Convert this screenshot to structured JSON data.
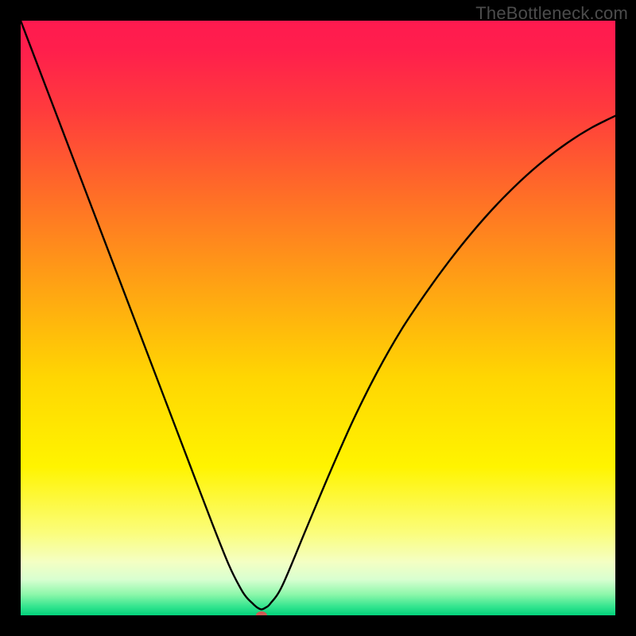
{
  "watermark": "TheBottleneck.com",
  "chart_data": {
    "type": "line",
    "title": "",
    "xlabel": "",
    "ylabel": "",
    "xlim": [
      0,
      100
    ],
    "ylim": [
      0,
      100
    ],
    "grid": false,
    "legend": false,
    "gradient_stops": [
      {
        "offset": 0.0,
        "color": "#ff1a4f"
      },
      {
        "offset": 0.05,
        "color": "#ff1f4c"
      },
      {
        "offset": 0.15,
        "color": "#ff3b3d"
      },
      {
        "offset": 0.3,
        "color": "#ff7026"
      },
      {
        "offset": 0.45,
        "color": "#ffa413"
      },
      {
        "offset": 0.6,
        "color": "#ffd602"
      },
      {
        "offset": 0.75,
        "color": "#fff400"
      },
      {
        "offset": 0.86,
        "color": "#fbfd7a"
      },
      {
        "offset": 0.91,
        "color": "#f4ffc3"
      },
      {
        "offset": 0.94,
        "color": "#d8ffd0"
      },
      {
        "offset": 0.965,
        "color": "#8cf7aa"
      },
      {
        "offset": 0.985,
        "color": "#35e58f"
      },
      {
        "offset": 1.0,
        "color": "#03d17b"
      }
    ],
    "marker": {
      "x": 40.5,
      "y": 0,
      "color": "#cf5a55",
      "rx": 7,
      "ry": 5
    },
    "series": [
      {
        "name": "bottleneck-curve",
        "x": [
          0,
          4,
          8,
          12,
          16,
          20,
          24,
          28,
          32,
          35,
          37,
          38,
          39,
          39.8,
          40.5,
          41.2,
          42,
          44,
          48,
          52,
          56,
          60,
          64,
          68,
          72,
          76,
          80,
          84,
          88,
          92,
          96,
          100
        ],
        "values": [
          100,
          89.5,
          79,
          68.5,
          58,
          47.5,
          37,
          26.5,
          16,
          8.5,
          4.5,
          3.0,
          2.0,
          1.3,
          1.0,
          1.3,
          2.0,
          5.0,
          14.5,
          24,
          33,
          41,
          48,
          54,
          59.5,
          64.5,
          69,
          73,
          76.5,
          79.5,
          82,
          84
        ]
      }
    ]
  }
}
